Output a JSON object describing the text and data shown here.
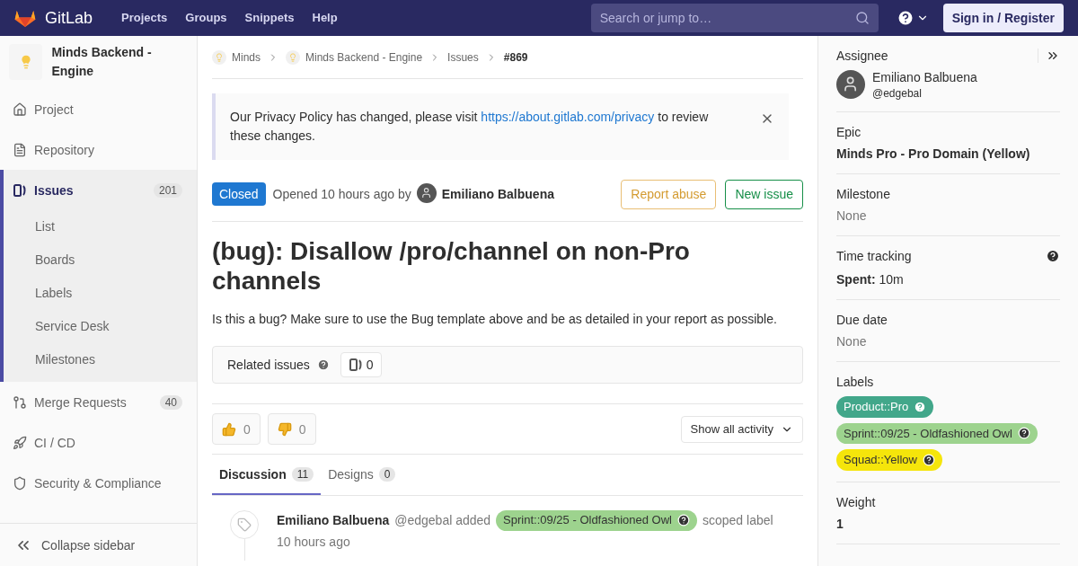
{
  "topbar": {
    "logo_text": "GitLab",
    "nav": [
      "Projects",
      "Groups",
      "Snippets",
      "Help"
    ],
    "search": {
      "placeholder": "Search or jump to…"
    },
    "sign_in": "Sign in / Register"
  },
  "sidebar": {
    "project_name": "Minds Backend - Engine",
    "items": [
      {
        "label": "Project",
        "selected": false
      },
      {
        "label": "Repository",
        "selected": false
      },
      {
        "label": "Issues",
        "count": "201",
        "selected": true,
        "children": [
          {
            "label": "List"
          },
          {
            "label": "Boards"
          },
          {
            "label": "Labels"
          },
          {
            "label": "Service Desk"
          },
          {
            "label": "Milestones"
          }
        ]
      },
      {
        "label": "Merge Requests",
        "count": "40",
        "selected": false
      },
      {
        "label": "CI / CD",
        "selected": false
      },
      {
        "label": "Security & Compliance",
        "selected": false
      }
    ],
    "collapse": "Collapse sidebar"
  },
  "breadcrumbs": [
    {
      "label": "Minds",
      "avatar": true,
      "current": false
    },
    {
      "label": "Minds Backend - Engine",
      "avatar": true,
      "current": false
    },
    {
      "label": "Issues",
      "avatar": false,
      "current": false
    },
    {
      "label": "#869",
      "avatar": false,
      "current": true
    }
  ],
  "alert": {
    "before": "Our Privacy Policy has changed, please visit ",
    "link": "https://about.gitlab.com/privacy",
    "after": " to review these changes."
  },
  "issue": {
    "status": "Closed",
    "opened": "Opened 10 hours ago by",
    "author": "Emiliano Balbuena",
    "buttons": [
      {
        "label": "Report abuse",
        "kind": "warning"
      },
      {
        "label": "New issue",
        "kind": "success"
      }
    ],
    "title": "(bug): Disallow /pro/channel on non-Pro channels",
    "description": "Is this a bug? Make sure to use the Bug template above and be as detailed in your report as possible.",
    "related": {
      "label": "Related issues",
      "count": "0"
    },
    "reactions": [
      {
        "kind": "thumbsup",
        "count": "0"
      },
      {
        "kind": "thumbsdown",
        "count": "0"
      }
    ],
    "activity_filter": "Show all activity",
    "tabs": [
      {
        "label": "Discussion",
        "count": "11",
        "selected": true
      },
      {
        "label": "Designs",
        "count": "0",
        "selected": false
      }
    ],
    "note": {
      "author": "Emiliano Balbuena",
      "action": "@edgebal added",
      "label": {
        "text": "Sprint::09/25 - Oldfashioned Owl",
        "color": "#9dd38e"
      },
      "suffix": "scoped label",
      "time": "10 hours ago"
    }
  },
  "right_sidebar": {
    "assignee": {
      "heading": "Assignee",
      "name": "Emiliano Balbuena",
      "handle": "@edgebal"
    },
    "epic": {
      "heading": "Epic",
      "value": "Minds Pro - Pro Domain (Yellow)"
    },
    "milestone": {
      "heading": "Milestone",
      "value": "None"
    },
    "time_tracking": {
      "heading": "Time tracking",
      "value": "**Spent:** 10m"
    },
    "due_date": {
      "heading": "Due date",
      "value": "None"
    },
    "labels": {
      "heading": "Labels",
      "items": [
        {
          "text": "Product::Pro",
          "color": "#42a78a"
        },
        {
          "text": "Sprint::09/25 - Oldfashioned Owl",
          "color": "#9dd38e"
        },
        {
          "text": "Squad::Yellow",
          "color": "#f5e50b"
        }
      ]
    },
    "weight": {
      "heading": "Weight",
      "value": "1"
    }
  }
}
